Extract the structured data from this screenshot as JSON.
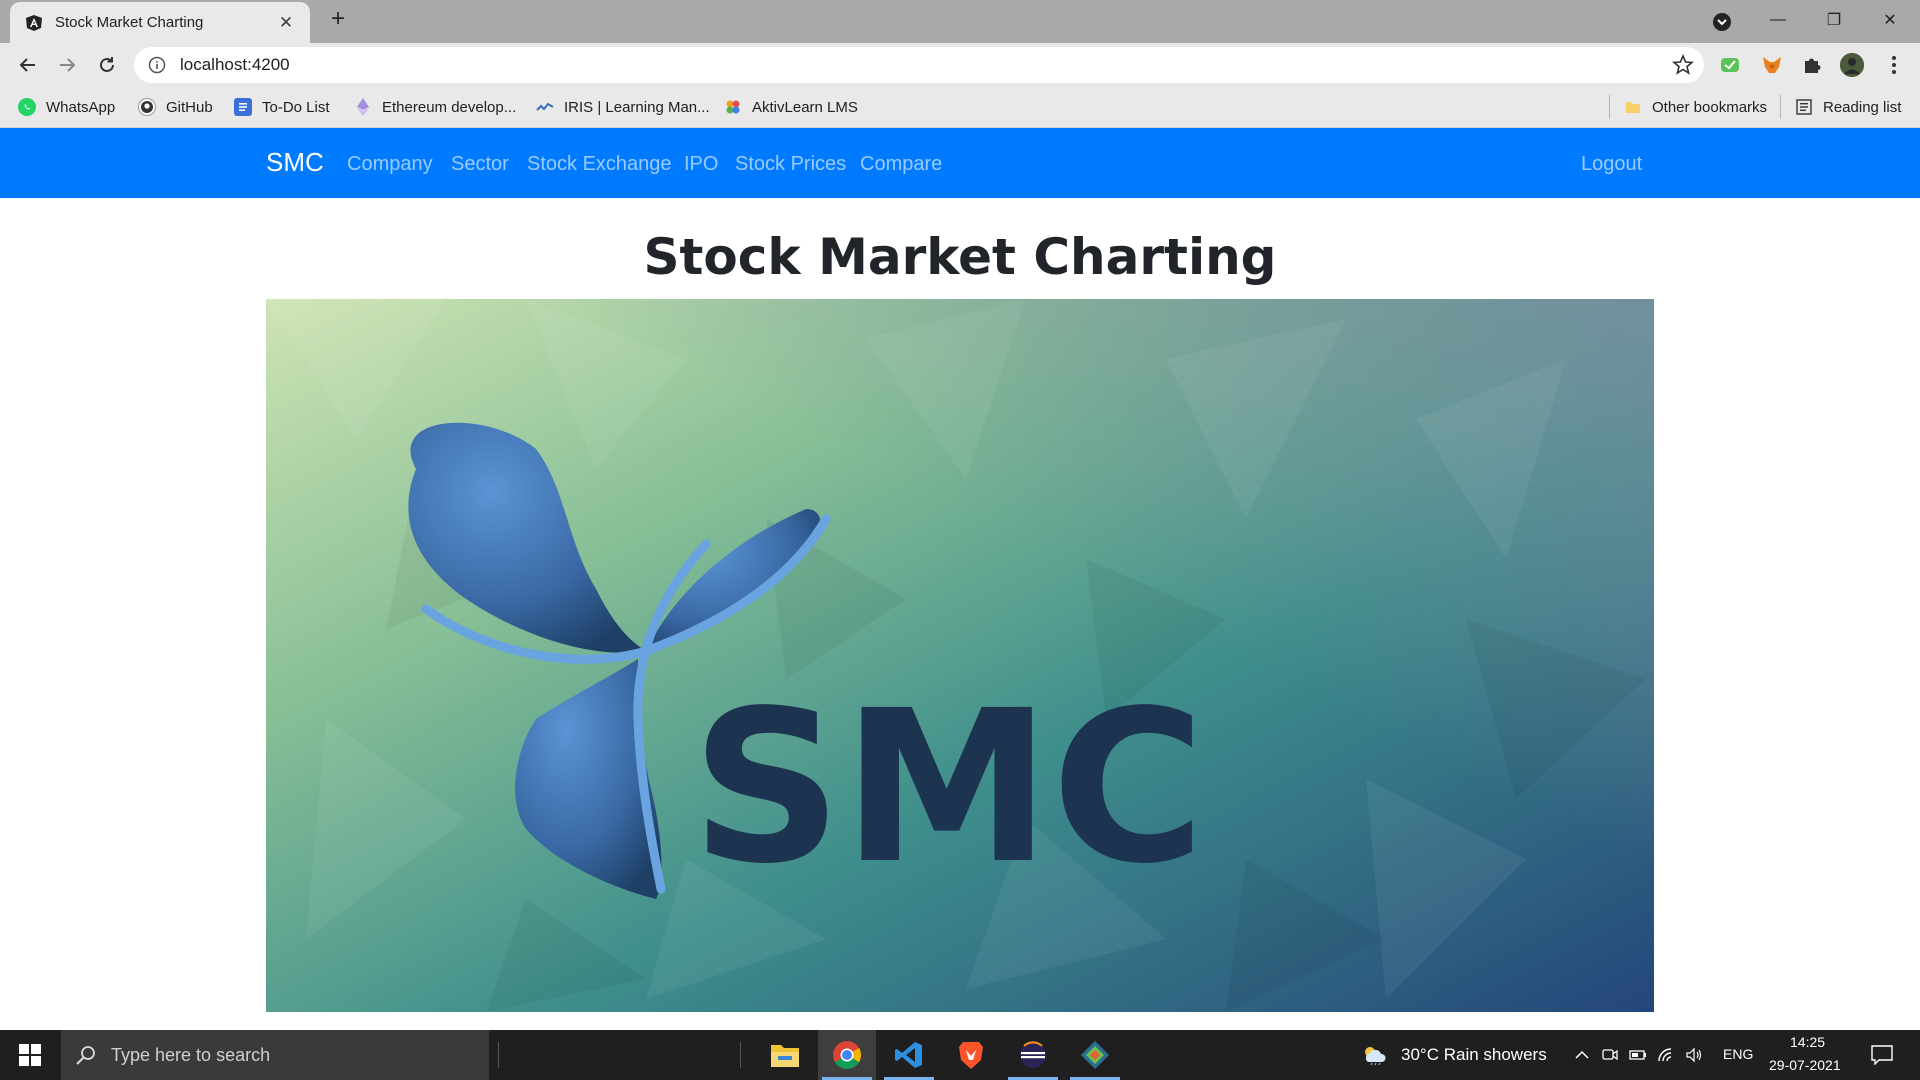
{
  "browser": {
    "tab": {
      "title": "Stock Market Charting",
      "close": "✕"
    },
    "new_tab": "+",
    "window": {
      "minimize": "—",
      "restore": "❐",
      "close": "✕"
    },
    "url": "localhost:4200",
    "bookmarks": [
      {
        "label": "WhatsApp",
        "icon": "whatsapp-icon"
      },
      {
        "label": "GitHub",
        "icon": "github-icon"
      },
      {
        "label": "To-Do List",
        "icon": "todo-icon"
      },
      {
        "label": "Ethereum develop...",
        "icon": "ethereum-icon"
      },
      {
        "label": "IRIS | Learning Man...",
        "icon": "iris-icon"
      },
      {
        "label": "AktivLearn LMS",
        "icon": "aktivlearn-icon"
      }
    ],
    "other_bookmarks": "Other bookmarks",
    "reading_list": "Reading list"
  },
  "navbar": {
    "brand": "SMC",
    "links": [
      "Company",
      "Sector",
      "Stock Exchange",
      "IPO",
      "Stock Prices",
      "Compare"
    ],
    "logout": "Logout"
  },
  "page": {
    "title": "Stock Market Charting",
    "hero_logo_text": "SMC"
  },
  "taskbar": {
    "search_placeholder": "Type here to search",
    "weather": "30°C  Rain showers",
    "language": "ENG",
    "time": "14:25",
    "date": "29-07-2021"
  },
  "colors": {
    "navbar": "#007bff",
    "taskbar": "#1f1f1f",
    "logo_text": "#1c344f",
    "logo_mark": "#3f74b0"
  }
}
